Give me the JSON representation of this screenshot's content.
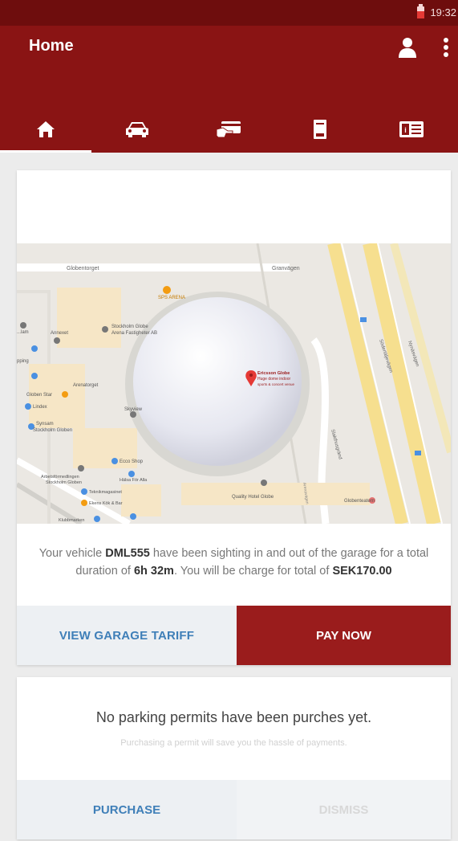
{
  "status_bar": {
    "time": "19:32"
  },
  "app_bar": {
    "title": "Home",
    "icons": [
      "account-icon",
      "more-vert-icon"
    ]
  },
  "tabs": [
    {
      "icon": "home-icon",
      "active": true
    },
    {
      "icon": "car-icon",
      "active": false
    },
    {
      "icon": "payment-icon",
      "active": false
    },
    {
      "icon": "receipt-icon",
      "active": false
    },
    {
      "icon": "wallet-icon",
      "active": false
    }
  ],
  "garage_card": {
    "map_labels": {
      "globentorget": "Globentorget",
      "granvagen": "Granvägen",
      "sps_arena": "SPS ARENA",
      "stockholm_globe_arena": "Stockholm Globe",
      "stockholm_globe_arena_2": "Arena Fastigheter AB",
      "ericsson_globe": "Ericsson Globe",
      "ericsson_globe_2": "Huge dome indoor",
      "ericsson_globe_3": "sports & concert venue",
      "arenaforget": "Arenatorget",
      "globen_star": "Globen Star",
      "lindex": "Lindex",
      "synsam": "Synsam",
      "synsam_2": "Stockholm Globen",
      "skyview": "Skyview",
      "ecco_shop": "Ecco Shop",
      "arbetsformedlingen": "Arbetsförmedlingen",
      "arbetsformedlingen_2": "Stockholm Globen",
      "halsa_for_alla": "Hälsa För Alla",
      "teknikmagasinet": "Teknikmagasinet",
      "ekens_kok": "Ekens Kök & Bar",
      "quality_hotel": "Quality Hotel Globe",
      "globenteatern": "Globenteatern",
      "sodertaljevagen": "Södertäljevägen",
      "nynasvagen": "Nynäsvägen",
      "slakthusgrand": "Slakthusgränd",
      "arenavagen": "Arenavägen",
      "klubbmarken": "Klubbmarken",
      "ann": "Annexet",
      "lam": "...lam",
      "pping": "pping"
    },
    "message": {
      "p1": "Your vehicle ",
      "plate": "DML555",
      "p2": " have been sighting in and out of the garage for a total duration of ",
      "duration": "6h 32m",
      "p3": ". You will be charge for total of ",
      "amount": "SEK170.00"
    },
    "view_tariff_label": "VIEW GARAGE TARIFF",
    "pay_now_label": "PAY NOW"
  },
  "permits_card": {
    "heading": "No parking permits have been purches yet.",
    "subtext": "Purchasing a permit will save you the hassle of payments.",
    "purchase_label": "PURCHASE",
    "dismiss_label": "DISMISS"
  },
  "colors": {
    "status_bar": "#6e0d0d",
    "app_bar": "#8a1414",
    "primary_button": "#9a1c1c",
    "link_blue": "#3f7fb8"
  }
}
